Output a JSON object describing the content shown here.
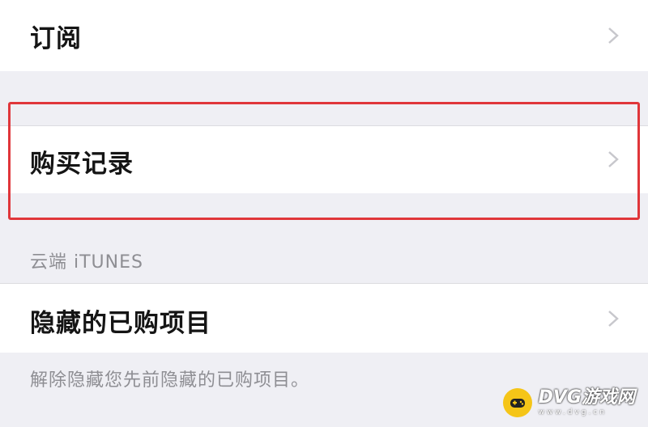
{
  "menu": {
    "subscriptions_label": "订阅",
    "purchase_history_label": "购买记录"
  },
  "itunes_section": {
    "header": "云端 iTUNES",
    "hidden_purchases_label": "隐藏的已购项目",
    "footnote": "解除隐藏您先前隐藏的已购项目。"
  },
  "watermark": {
    "title": "DVG游戏网",
    "subtitle": "www.dvg.cn"
  },
  "colors": {
    "highlight": "#e0363a",
    "background": "#efeff4",
    "row": "#ffffff",
    "secondary_text": "#8e8e93"
  }
}
